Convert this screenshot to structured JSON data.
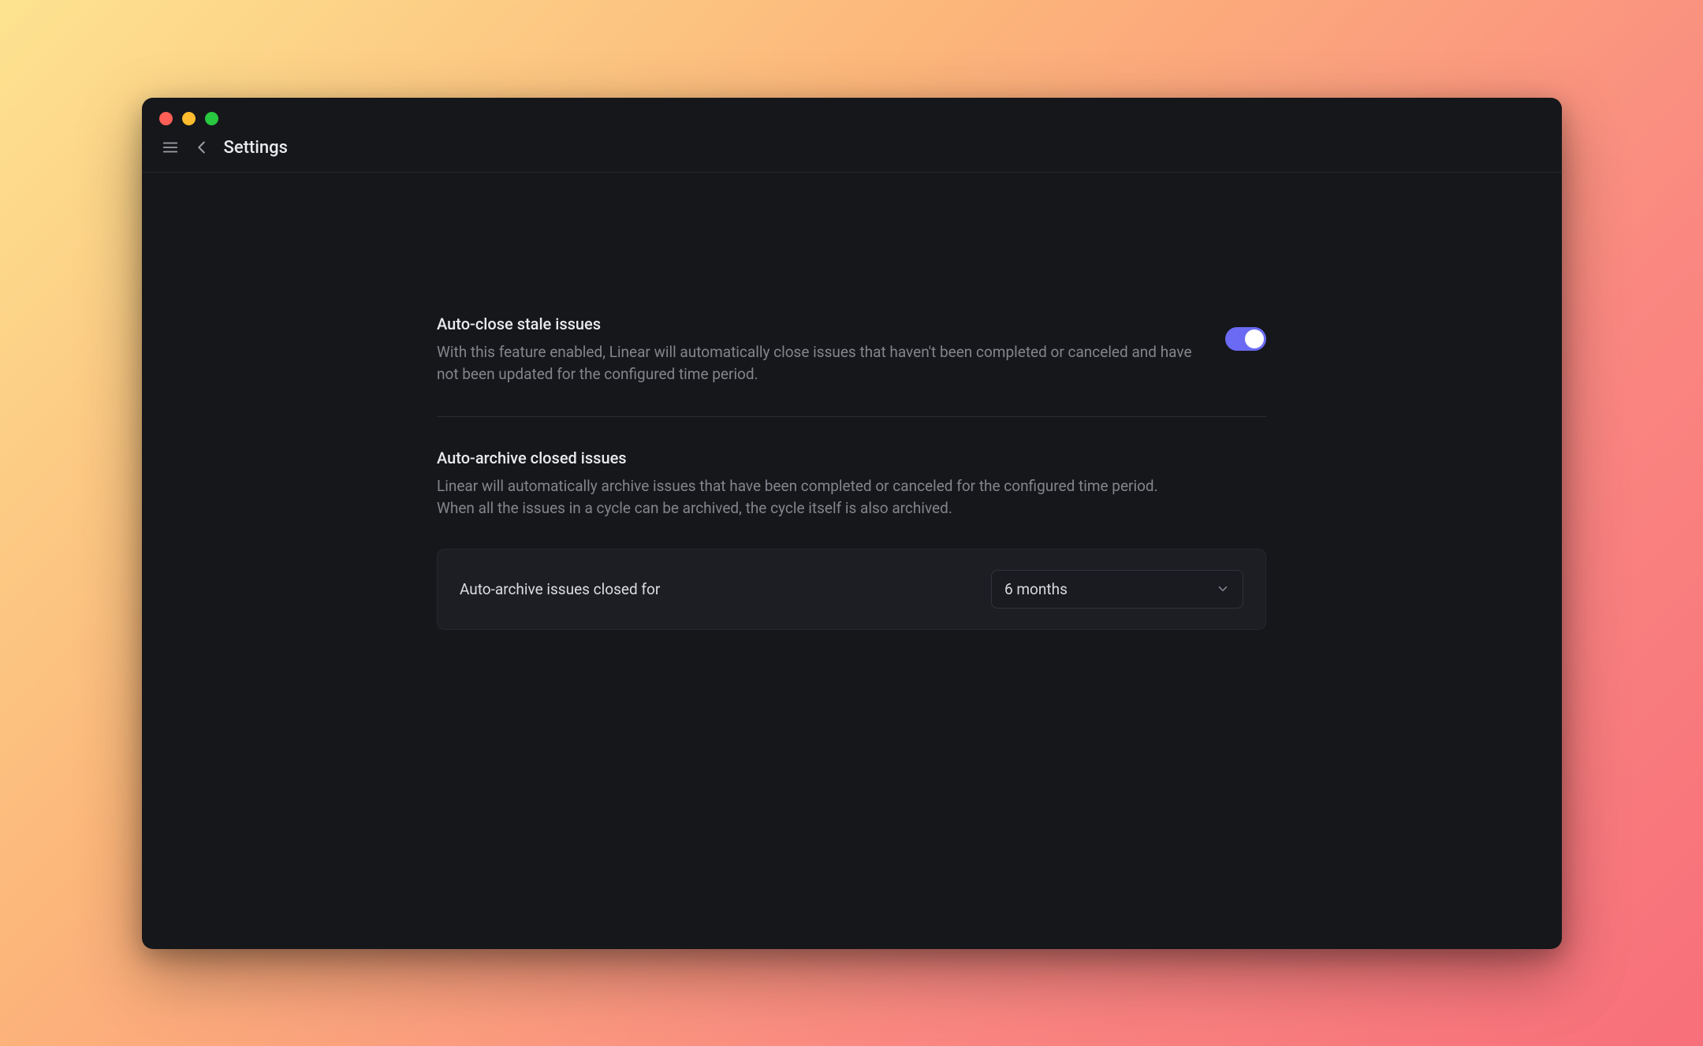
{
  "header": {
    "title": "Settings"
  },
  "sections": {
    "autoClose": {
      "title": "Auto-close stale issues",
      "description": "With this feature enabled, Linear will automatically close issues that haven't been completed or canceled and have not been updated for the configured time period.",
      "toggle_on": true
    },
    "autoArchive": {
      "title": "Auto-archive closed issues",
      "description": "Linear will automatically archive issues that have been completed or canceled for the configured time period. When all the issues in a cycle can be archived, the cycle itself is also archived.",
      "field_label": "Auto-archive issues closed for",
      "selected_value": "6 months"
    }
  }
}
